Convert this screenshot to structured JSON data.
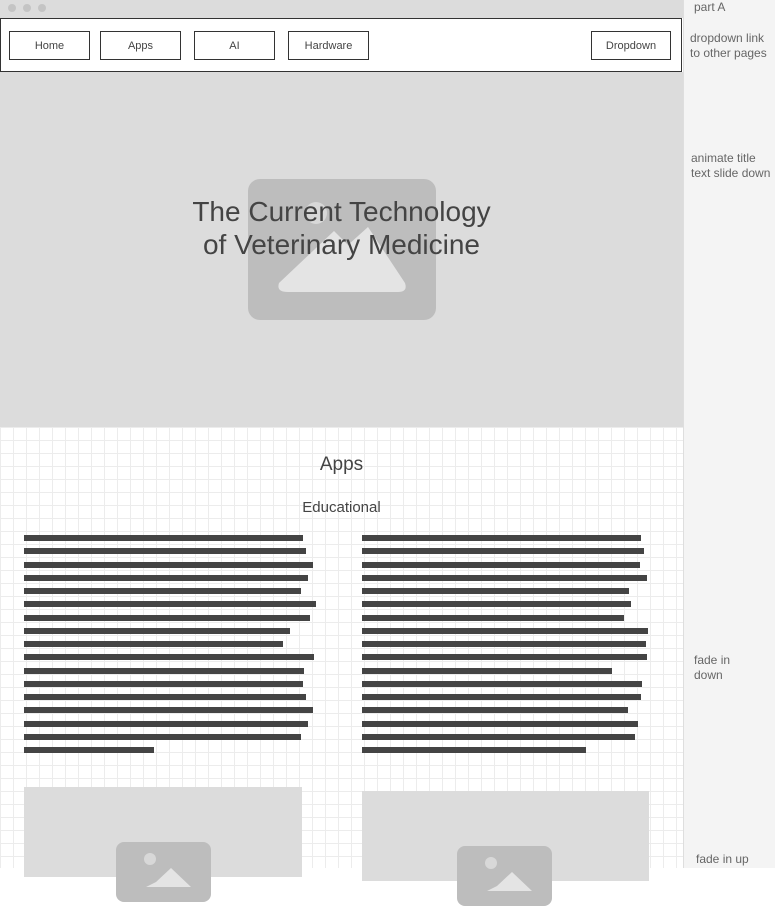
{
  "annotations": {
    "part": "part A",
    "dropdown_note": "dropdown link to other pages",
    "title_note": "animate title text slide down",
    "fade_down_note": "fade in down",
    "fade_up_note": "fade in up"
  },
  "nav": {
    "items": [
      {
        "label": "Home"
      },
      {
        "label": "Apps"
      },
      {
        "label": "AI"
      },
      {
        "label": "Hardware"
      }
    ],
    "dropdown_label": "Dropdown"
  },
  "hero": {
    "title_line1": "The Current Technology",
    "title_line2": "of Veterinary Medicine"
  },
  "section": {
    "title": "Apps",
    "subtitle": "Educational"
  },
  "colors": {
    "placeholder": "#dcdcdc",
    "placeholder_icon": "#bdbdbd",
    "text_bar": "#444444"
  }
}
